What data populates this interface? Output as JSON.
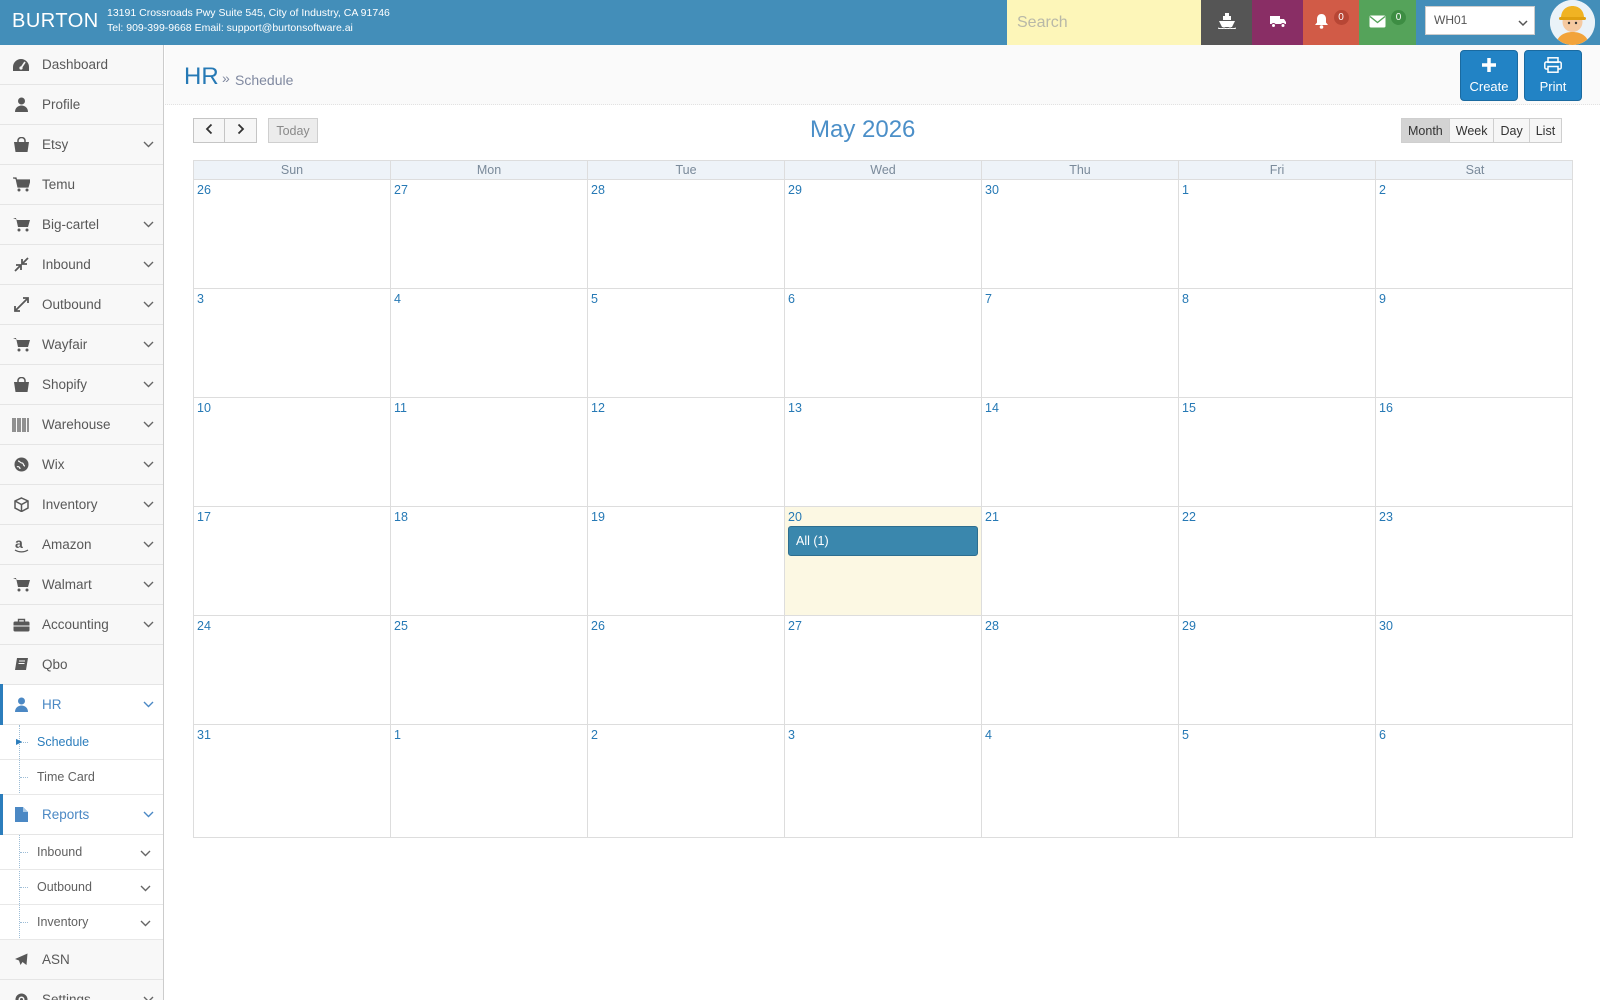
{
  "navbar": {
    "brand": "BURTON",
    "address_line1": "13191 Crossroads Pwy Suite 545, City of Industry, CA 91746",
    "address_line2": "Tel: 909-399-9668 Email: support@burtonsoftware.ai",
    "search_placeholder": "Search",
    "notifications_count": "0",
    "messages_count": "0",
    "warehouse": "WH01",
    "colors": {
      "bar": "#438eb9",
      "ship": "#555555",
      "truck": "#892e65",
      "bell": "#d15b47",
      "mail": "#55a35a"
    }
  },
  "sidebar": {
    "items": [
      {
        "label": "Dashboard",
        "icon": "dashboard-icon"
      },
      {
        "label": "Profile",
        "icon": "user-icon"
      },
      {
        "label": "Etsy",
        "icon": "shopping-bag-icon"
      },
      {
        "label": "Temu",
        "icon": "cart-icon"
      },
      {
        "label": "Big-cartel",
        "icon": "cart-icon"
      },
      {
        "label": "Inbound",
        "icon": "compress-icon"
      },
      {
        "label": "Outbound",
        "icon": "expand-icon"
      },
      {
        "label": "Wayfair",
        "icon": "cart-icon"
      },
      {
        "label": "Shopify",
        "icon": "shopping-bag-icon"
      },
      {
        "label": "Warehouse",
        "icon": "barcode-icon"
      },
      {
        "label": "Wix",
        "icon": "globe-icon"
      },
      {
        "label": "Inventory",
        "icon": "cube-icon"
      },
      {
        "label": "Amazon",
        "icon": "amazon-icon"
      },
      {
        "label": "Walmart",
        "icon": "cart-icon"
      },
      {
        "label": "Accounting",
        "icon": "briefcase-icon"
      },
      {
        "label": "Qbo",
        "icon": "book-icon"
      },
      {
        "label": "HR",
        "icon": "user-icon"
      },
      {
        "label": "Reports",
        "icon": "file-icon"
      },
      {
        "label": "ASN",
        "icon": "plane-icon"
      },
      {
        "label": "Settings",
        "icon": "gear-icon"
      }
    ],
    "hr_sub": [
      "Schedule",
      "Time Card"
    ],
    "reports_sub": [
      "Inbound",
      "Outbound",
      "Inventory"
    ]
  },
  "header": {
    "title": "HR",
    "separator": "»",
    "subtitle": "Schedule",
    "create_label": "Create",
    "print_label": "Print"
  },
  "calendar": {
    "title": "May 2026",
    "today_label": "Today",
    "views": [
      "Month",
      "Week",
      "Day",
      "List"
    ],
    "active_view": "Month",
    "weekdays": [
      "Sun",
      "Mon",
      "Tue",
      "Wed",
      "Thu",
      "Fri",
      "Sat"
    ],
    "weeks": [
      [
        "26",
        "27",
        "28",
        "29",
        "30",
        "1",
        "2"
      ],
      [
        "3",
        "4",
        "5",
        "6",
        "7",
        "8",
        "9"
      ],
      [
        "10",
        "11",
        "12",
        "13",
        "14",
        "15",
        "16"
      ],
      [
        "17",
        "18",
        "19",
        "20",
        "21",
        "22",
        "23"
      ],
      [
        "24",
        "25",
        "26",
        "27",
        "28",
        "29",
        "30"
      ],
      [
        "31",
        "1",
        "2",
        "3",
        "4",
        "5",
        "6"
      ]
    ],
    "today_date": "20",
    "event_label": "All (1)"
  }
}
